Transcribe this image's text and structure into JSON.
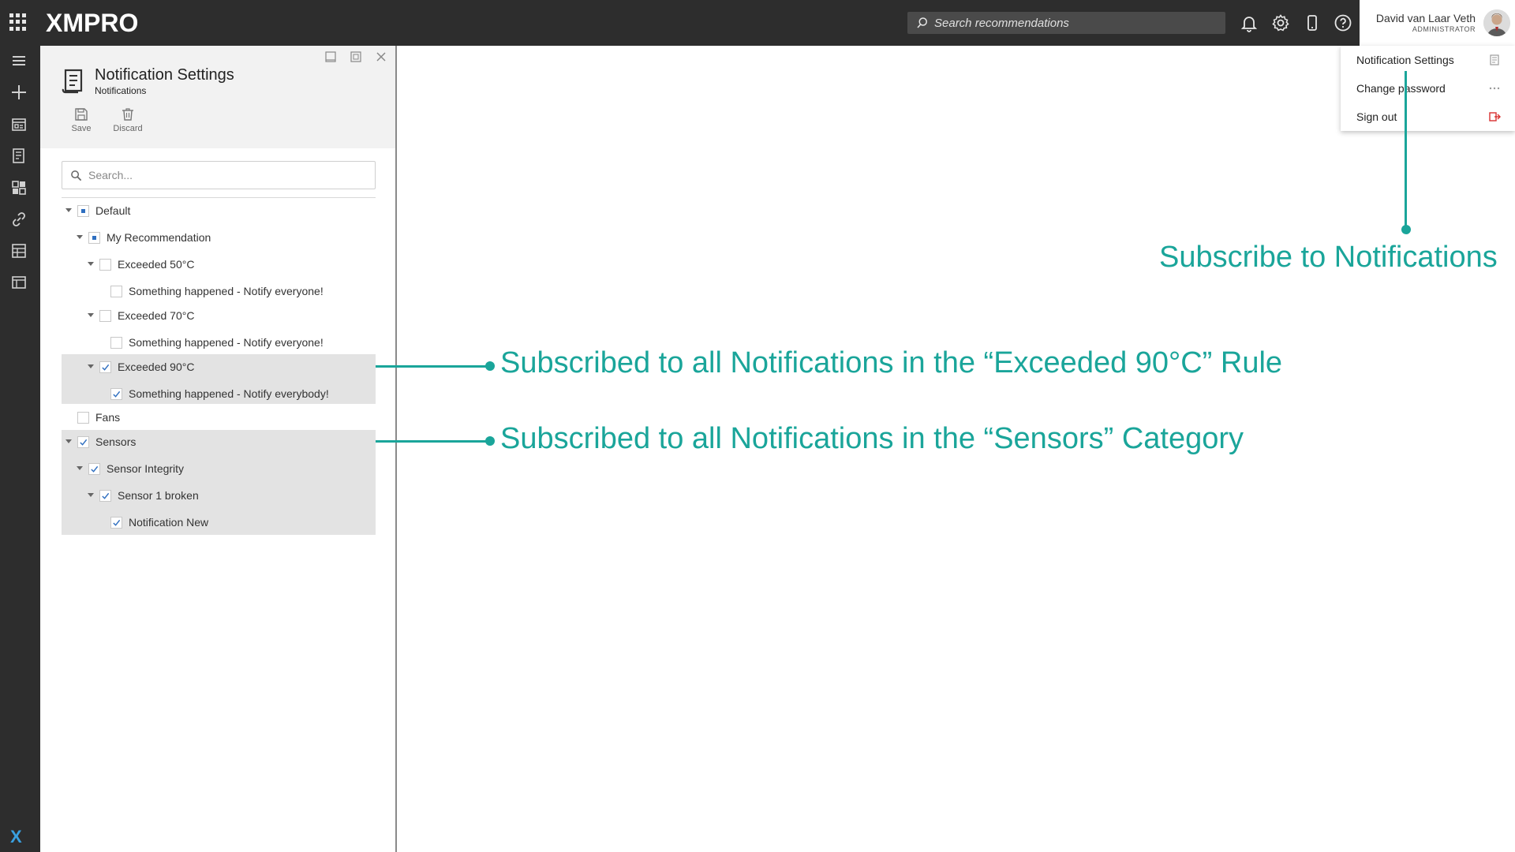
{
  "topbar": {
    "logo": "XMPRO",
    "search_placeholder": "Search recommendations",
    "user_name": "David van Laar Veth",
    "user_role": "ADMINISTRATOR"
  },
  "user_menu": {
    "items": [
      {
        "label": "Notification Settings",
        "icon": "notification-settings-icon"
      },
      {
        "label": "Change password",
        "icon": "dots-icon"
      },
      {
        "label": "Sign out",
        "icon": "sign-out-icon"
      }
    ]
  },
  "rail": {
    "icons": [
      "menu-icon",
      "add-icon",
      "dashboard-icon",
      "recommendations-icon",
      "apps-icon",
      "link-icon",
      "data-icon",
      "view-icon"
    ],
    "bottom_logo": "X"
  },
  "panel": {
    "title": "Notification Settings",
    "subtitle": "Notifications",
    "save_label": "Save",
    "discard_label": "Discard",
    "search_placeholder": "Search..."
  },
  "tree": [
    {
      "label": "Default",
      "level": 0,
      "state": "partial",
      "expandable": true
    },
    {
      "label": "My Recommendation",
      "level": 1,
      "state": "partial",
      "expandable": true
    },
    {
      "label": "Exceeded 50°C",
      "level": 2,
      "state": "unchecked",
      "expandable": true
    },
    {
      "label": "Something happened - Notify everyone!",
      "level": 3,
      "state": "unchecked",
      "expandable": false
    },
    {
      "label": "Exceeded 70°C",
      "level": 2,
      "state": "unchecked",
      "expandable": true
    },
    {
      "label": "Something happened - Notify everyone!",
      "level": 3,
      "state": "unchecked",
      "expandable": false
    },
    {
      "label": "Exceeded 90°C",
      "level": 2,
      "state": "checked",
      "expandable": true
    },
    {
      "label": "Something happened - Notify everybody!",
      "level": 3,
      "state": "checked",
      "expandable": false
    },
    {
      "label": "Fans",
      "level": 0,
      "state": "unchecked",
      "expandable": false
    },
    {
      "label": "Sensors",
      "level": 0,
      "state": "checked",
      "expandable": true
    },
    {
      "label": "Sensor Integrity",
      "level": 1,
      "state": "checked",
      "expandable": true
    },
    {
      "label": "Sensor 1 broken",
      "level": 2,
      "state": "checked",
      "expandable": true
    },
    {
      "label": "Notification New",
      "level": 3,
      "state": "checked",
      "expandable": false
    }
  ],
  "annotations": {
    "subscribe": "Subscribe to Notifications",
    "rule": "Subscribed to all Notifications in the “Exceeded 90°C” Rule",
    "category": "Subscribed to all Notifications in the “Sensors” Category"
  },
  "colors": {
    "topbar": "#2d2d2d",
    "accent": "#1aa59a",
    "checkbox_blue": "#2f6fc0",
    "highlight": "#e3e3e3"
  }
}
